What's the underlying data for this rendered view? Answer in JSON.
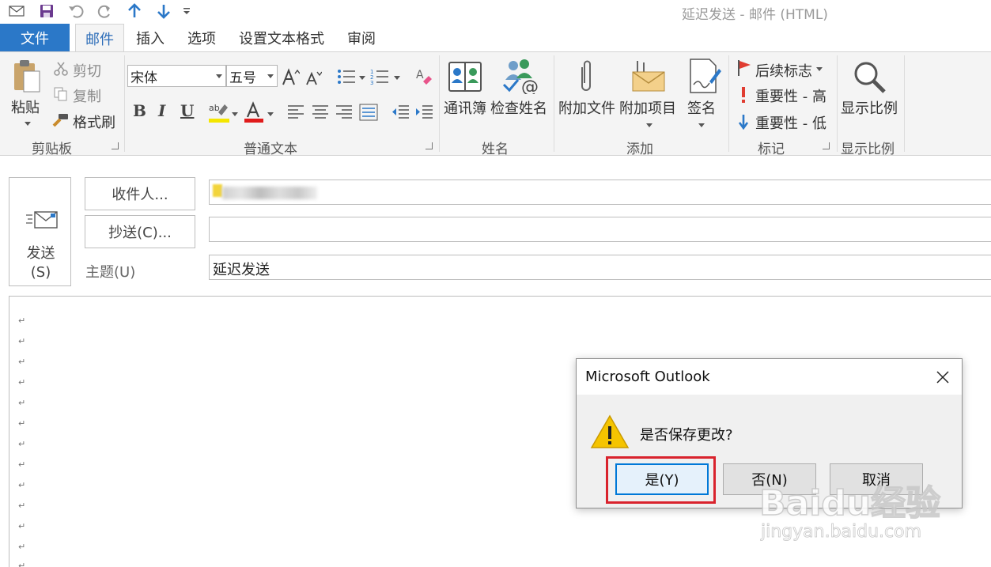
{
  "window": {
    "title": "延迟发送 - 邮件 (HTML)"
  },
  "tabs": [
    {
      "label": "文件"
    },
    {
      "label": "邮件"
    },
    {
      "label": "插入"
    },
    {
      "label": "选项"
    },
    {
      "label": "设置文本格式"
    },
    {
      "label": "审阅"
    }
  ],
  "ribbon": {
    "clipboard": {
      "group_label": "剪贴板",
      "paste": "粘贴",
      "cut": "剪切",
      "copy": "复制",
      "format_painter": "格式刷"
    },
    "basic_text": {
      "group_label": "普通文本",
      "font_name": "宋体",
      "font_size": "五号",
      "bold": "B",
      "italic": "I",
      "underline": "U"
    },
    "names": {
      "group_label": "姓名",
      "address_book": "通讯簿",
      "check_names": "检查姓名"
    },
    "include": {
      "group_label": "添加",
      "attach_file": "附加文件",
      "attach_item": "附加项目",
      "signature": "签名"
    },
    "tags": {
      "group_label": "标记",
      "follow_up": "后续标志",
      "high_importance": "重要性 - 高",
      "low_importance": "重要性 - 低"
    },
    "zoom": {
      "group_label": "显示比例",
      "zoom": "显示比例"
    }
  },
  "compose": {
    "send": "发送",
    "send_key": "(S)",
    "to_button": "收件人...",
    "cc_button": "抄送(C)...",
    "subject_label": "主题(U)",
    "subject_value": "延迟发送",
    "cc_value": "",
    "paragraph_mark": "↵"
  },
  "dialog": {
    "title": "Microsoft Outlook",
    "message": "是否保存更改?",
    "buttons": {
      "yes": "是(Y)",
      "no": "否(N)",
      "cancel": "取消"
    }
  },
  "watermark": {
    "brand": "Baidu经验",
    "url": "jingyan.baidu.com"
  },
  "colors": {
    "accent": "#2b78c8",
    "highlight": "#d9232d",
    "warning": "#f5c400",
    "flag": "#e03c31"
  }
}
